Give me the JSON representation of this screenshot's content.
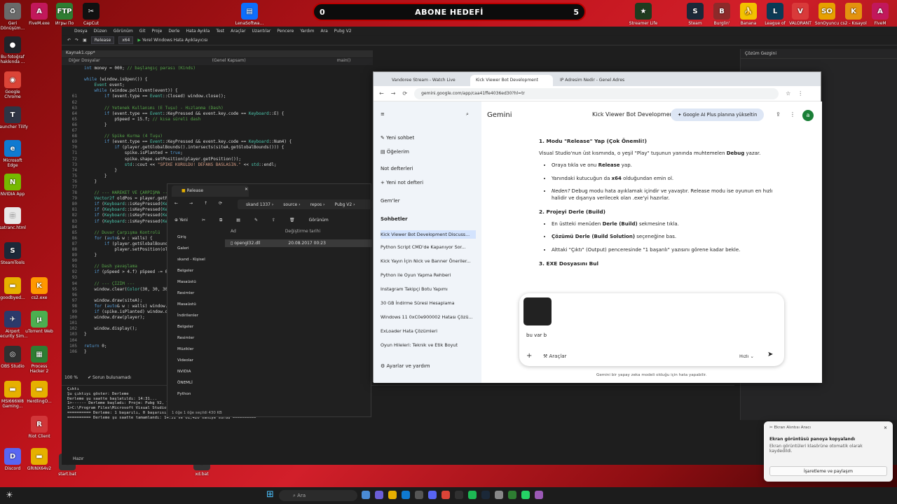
{
  "banner": {
    "left_count": "0",
    "title": "ABONE HEDEFİ",
    "right_count": "5"
  },
  "desktop_icons_left": [
    {
      "label": "Geri Dönüşüm...",
      "color": "#6a6a6a",
      "glyph": "♻"
    },
    {
      "label": "Bu fotoğraf hakkında ...",
      "color": "#20242a",
      "glyph": "●"
    },
    {
      "label": "Google Chrome",
      "color": "#db4437",
      "glyph": "◉"
    },
    {
      "label": "Launcher Tilify",
      "color": "#2f3545",
      "glyph": "T"
    },
    {
      "label": "Microsoft Edge",
      "color": "#0f7ad1",
      "glyph": "e"
    },
    {
      "label": "NVIDIA App",
      "color": "#76b900",
      "glyph": "N"
    },
    {
      "label": "satranc.html",
      "color": "#e8e8e8",
      "glyph": "≡"
    },
    {
      "label": "SteamTools",
      "color": "#1b2838",
      "glyph": "S"
    },
    {
      "label": "goodbyed...",
      "color": "#e6b000",
      "glyph": "▬"
    },
    {
      "label": "Airport Security Sim...",
      "color": "#2b3a6b",
      "glyph": "✈"
    },
    {
      "label": "OBS Studio",
      "color": "#303030",
      "glyph": "◎"
    },
    {
      "label": "MSI666W8 Gaming...",
      "color": "#e6b000",
      "glyph": "▬"
    },
    {
      "label": "Discord",
      "color": "#5865f2",
      "glyph": "D"
    }
  ],
  "desktop_icons_col2": [
    {
      "label": "FiveM.exe",
      "color": "#c2185b",
      "glyph": "A"
    },
    {
      "label": "cs2.exe",
      "color": "#ff9800",
      "glyph": "K"
    },
    {
      "label": "uTorrent Web",
      "color": "#4caf50",
      "glyph": "μ"
    },
    {
      "label": "Process Hacker 2",
      "color": "#2e7d32",
      "glyph": "▦"
    },
    {
      "label": "HerdlingO...",
      "color": "#e6b000",
      "glyph": "▬"
    },
    {
      "label": "Riot Client",
      "color": "#d13639",
      "glyph": "R"
    },
    {
      "label": "GRINX64v2",
      "color": "#e6b000",
      "glyph": "▬"
    }
  ],
  "desktop_icons_top": [
    {
      "label": "Игры По",
      "color": "#2e7d32",
      "glyph": "FTP"
    },
    {
      "label": "CapCut",
      "color": "#111",
      "glyph": "✂"
    },
    {
      "label": "LenaSoftwa...",
      "color": "#0d6efd",
      "glyph": "▤"
    },
    {
      "label": "Streamer Life",
      "color": "#1f3b1f",
      "glyph": "★"
    },
    {
      "label": "Steam",
      "color": "#1b2838",
      "glyph": "S"
    },
    {
      "label": "Burglin'",
      "color": "#8d2a2a",
      "glyph": "B"
    },
    {
      "label": "Banana",
      "color": "#f2c200",
      "glyph": "🍌"
    },
    {
      "label": "League of",
      "color": "#0b3a55",
      "glyph": "L"
    },
    {
      "label": "VALORANT",
      "color": "#d93a3a",
      "glyph": "V"
    },
    {
      "label": "SonOyuncu",
      "color": "#e6a000",
      "glyph": "SO"
    },
    {
      "label": "cs2 - Kısayol",
      "color": "#e3930f",
      "glyph": "K"
    },
    {
      "label": "FiveM",
      "color": "#c2185b",
      "glyph": "A"
    }
  ],
  "desktop_icons_right": [
    {
      "label": "Euro Truck Simulator 2",
      "color": "#1565c0",
      "glyph": "ETS"
    }
  ],
  "desktop_bottom_files": [
    "start.bat",
    "xd.bat"
  ],
  "vs": {
    "menu": [
      "Dosya",
      "Düzen",
      "Görünüm",
      "Git",
      "Proje",
      "Derle",
      "Hata Ayıkla",
      "Test",
      "Araçlar",
      "Uzantılar",
      "Pencere",
      "Yardım",
      "Ara",
      "Pubg V2"
    ],
    "config": "Release",
    "platform": "x64",
    "run_label": "Yerel Windows Hata Ayıklayıcısı",
    "file_tab": "Kaynak1.cpp*",
    "scope_left": "Diğer Dosyalar",
    "scope_mid": "(Genel Kapsam)",
    "scope_right": "main()",
    "zoom": "100 %",
    "issues": "Sorun bulunamadı",
    "status": "Hazır",
    "solution_title": "Çözüm Gezgini",
    "output_title": "Çıktı",
    "output_source_label": "Şu çıktıyı göster:",
    "output_source": "Derleme",
    "output_lines": [
      "Derleme şu saatte başlatıldı: 14:31...",
      "1>------ Derleme başladı: Proje: Pubg V2, Yapılandırma: Release x64 ------",
      "1>C:\\Program Files\\Microsoft Visual Studio\\...",
      "========== Derleme: 1 başarılı, 0 başarısız, 0 güncel, 0 atlandı ==========",
      "========== Derleme şu saatte tamamlandı: 14:31 ve 01,420 saniye sürdü =========="
    ],
    "code_lines": [
      {
        "n": "",
        "t": "int money = 000; // başlangıç parası (Kinds)"
      },
      {
        "n": "",
        "t": ""
      },
      {
        "n": "",
        "t": "while (window.isOpen()) {"
      },
      {
        "n": "",
        "t": "    Event event;"
      },
      {
        "n": "",
        "t": "    while (window.pollEvent(event)) {"
      },
      {
        "n": "61",
        "t": "        if (event.type == Event::Closed) window.close();"
      },
      {
        "n": "62",
        "t": ""
      },
      {
        "n": "63",
        "t": "        // Yetenek Kullanımı (E Tuşu) - Hızlanma (Dash)"
      },
      {
        "n": "64",
        "t": "        if (event.type == Event::KeyPressed && event.key.code == Keyboard::E) {"
      },
      {
        "n": "65",
        "t": "            pSpeed = 15.f; // kısa süreli dash"
      },
      {
        "n": "66",
        "t": "        }"
      },
      {
        "n": "67",
        "t": ""
      },
      {
        "n": "68",
        "t": "        // Spike Kurma (4 Tuşu)"
      },
      {
        "n": "69",
        "t": "        if (event.type == Event::KeyPressed && event.key.code == Keyboard::Num4) {"
      },
      {
        "n": "70",
        "t": "            if (player.getGlobalBounds().intersects(siteA.getGlobalBounds())) {"
      },
      {
        "n": "71",
        "t": "                spike.isPlanted = true;"
      },
      {
        "n": "72",
        "t": "                spike.shape.setPosition(player.getPosition());"
      },
      {
        "n": "73",
        "t": "                std::cout << \"SPIKE KURULDU! DEFANS BASLASIN.\" << std::endl;"
      },
      {
        "n": "74",
        "t": "            }"
      },
      {
        "n": "75",
        "t": "        }"
      },
      {
        "n": "76",
        "t": "    }"
      },
      {
        "n": "77",
        "t": ""
      },
      {
        "n": "78",
        "t": "    // --- HAREKET VE ÇARPIŞMA ---"
      },
      {
        "n": "79",
        "t": "    Vector2f oldPos = player.getPosition();"
      },
      {
        "n": "80",
        "t": "    if (Keyboard::isKeyPressed(Keyboard::W))"
      },
      {
        "n": "81",
        "t": "    if (Keyboard::isKeyPressed(Keyboard::S))"
      },
      {
        "n": "82",
        "t": "    if (Keyboard::isKeyPressed(Keyboard::A))"
      },
      {
        "n": "83",
        "t": "    if (Keyboard::isKeyPressed(Keyboard::D))"
      },
      {
        "n": "84",
        "t": ""
      },
      {
        "n": "85",
        "t": "    // Duvar Çarpışma Kontrolü"
      },
      {
        "n": "86",
        "t": "    for (auto& w : walls) {"
      },
      {
        "n": "87",
        "t": "        if (player.getGlobalBounds()"
      },
      {
        "n": "88",
        "t": "            player.setPosition(oldPos);"
      },
      {
        "n": "89",
        "t": "    }"
      },
      {
        "n": "90",
        "t": ""
      },
      {
        "n": "91",
        "t": "    // Dash yavaşlama"
      },
      {
        "n": "92",
        "t": "    if (pSpeed > 4.f) pSpeed -= 0.5f;"
      },
      {
        "n": "93",
        "t": ""
      },
      {
        "n": "94",
        "t": "    // --- ÇİZİM ---"
      },
      {
        "n": "95",
        "t": "    window.clear(Color(30, 30, 30));"
      },
      {
        "n": "96",
        "t": ""
      },
      {
        "n": "97",
        "t": "    window.draw(siteA);"
      },
      {
        "n": "98",
        "t": "    for (auto& w : walls) window.draw(w);"
      },
      {
        "n": "99",
        "t": "    if (spike.isPlanted) window.draw(spike.shape);"
      },
      {
        "n": "100",
        "t": "    window.draw(player);"
      },
      {
        "n": "101",
        "t": ""
      },
      {
        "n": "102",
        "t": "    window.display();"
      },
      {
        "n": "103",
        "t": "}"
      },
      {
        "n": "104",
        "t": ""
      },
      {
        "n": "105",
        "t": "return 0;"
      },
      {
        "n": "106",
        "t": "}"
      }
    ]
  },
  "explorer": {
    "tab_title": "Release",
    "path": [
      "skand 1337",
      "source",
      "repos",
      "Pubg V2"
    ],
    "new_label": "Yeni",
    "view_label": "Görünüm",
    "sidebar": [
      "Giriş",
      "Galeri",
      "skand - Kişisel",
      "Belgeler",
      "Masaüstü",
      "Resimler",
      "Masaüstü",
      "İndirilenler",
      "Belgeler",
      "Resimler",
      "Müzikler",
      "Videolar",
      "NVIDIA",
      "ÖNEMLİ",
      "Python"
    ],
    "col_name": "Ad",
    "col_date": "Değiştirme tarihi",
    "file_name": "opengl32.dll",
    "file_date": "20.08.2017 00:23",
    "footer": "1 öğe   1 öğe seçildi  430 KB"
  },
  "chrome": {
    "tabs": [
      "Vandoree Stream - Watch Live",
      "Kick Viewer Bot Development",
      "IP Adresim Nedir - Genel Adres"
    ],
    "url": "gemini.google.com/app/caa41ffe4036ed30?hl=tr",
    "gemini": {
      "brand": "Gemini",
      "chat_title": "Kick Viewer Bot Development",
      "upgrade": "Google AI Plus planına yükseltin",
      "avatar_letter": "a",
      "sidebar_top": [
        "Yeni sohbet",
        "Öğelerim"
      ],
      "notes_header": "Not defterleri",
      "new_note": "Yeni not defteri",
      "gems": "Gem'ler",
      "chats_header": "Sohbetler",
      "history": [
        "Kick Viewer Bot Development Discuss...",
        "Python Script CMD'de Kapanıyor Sor...",
        "Kick Yayın İçin Nick ve Banner Öneriler...",
        "Python ile Oyun Yapma Rehberi",
        "Instagram Takipçi Botu Yapımı",
        "30 GB İndirme Süresi Hesaplama",
        "Windows 11 0xC0e900002 Hatası Çözü...",
        "ExLoader Hata Çözümleri",
        "Oyun Hileleri: Teknik ve Etik Boyut"
      ],
      "settings": "Ayarlar ve yardım",
      "answer": {
        "h1": "1. Modu \"Release\" Yap (Çok Önemli!)",
        "p1_a": "Visual Studio'nun üst kısmında, o yeşil \"Play\" tuşunun yanında muhtemelen ",
        "p1_b": "Debug",
        "p1_c": " yazar.",
        "li1_a": "Oraya tıkla ve onu ",
        "li1_b": "Release",
        "li1_c": " yap.",
        "li2_a": "Yanındaki kutucuğun da ",
        "li2_b": "x64",
        "li2_c": " olduğundan emin ol.",
        "li3_a": "Neden?",
        "li3_b": " Debug modu hata ayıklamak içindir ve yavaştır. Release modu ise oyunun en hızlı halidir ve dışarıya verilecek olan .exe'yi hazırlar.",
        "h2": "2. Projeyi Derle (Build)",
        "li4_a": "En üstteki menüden ",
        "li4_b": "Derle (Build)",
        "li4_c": " sekmesine tıkla.",
        "li5_a": "Çözümü Derle (Build Solution)",
        "li5_b": " seçeneğine bas.",
        "li6": "Alttaki \"Çıktı\" (Output) penceresinde \"1 başarılı\" yazısını görene kadar bekle.",
        "h3": "3. EXE Dosyasını Bul"
      },
      "prompt_text": "bu var b",
      "tools": "Araçlar",
      "model": "Hızlı",
      "disclaimer": "Gemini bir yapay zeka modeli olduğu için hata yapabilir."
    }
  },
  "toast": {
    "app": "Ekran Alıntısı Aracı",
    "title": "Ekran görüntüsü panoya kopyalandı",
    "body": "Ekran görüntüleri klasörüne otomatik olarak kaydedildi.",
    "button": "İşaretleme ve paylaşım"
  },
  "taskbar": {
    "search_placeholder": "Ara"
  }
}
